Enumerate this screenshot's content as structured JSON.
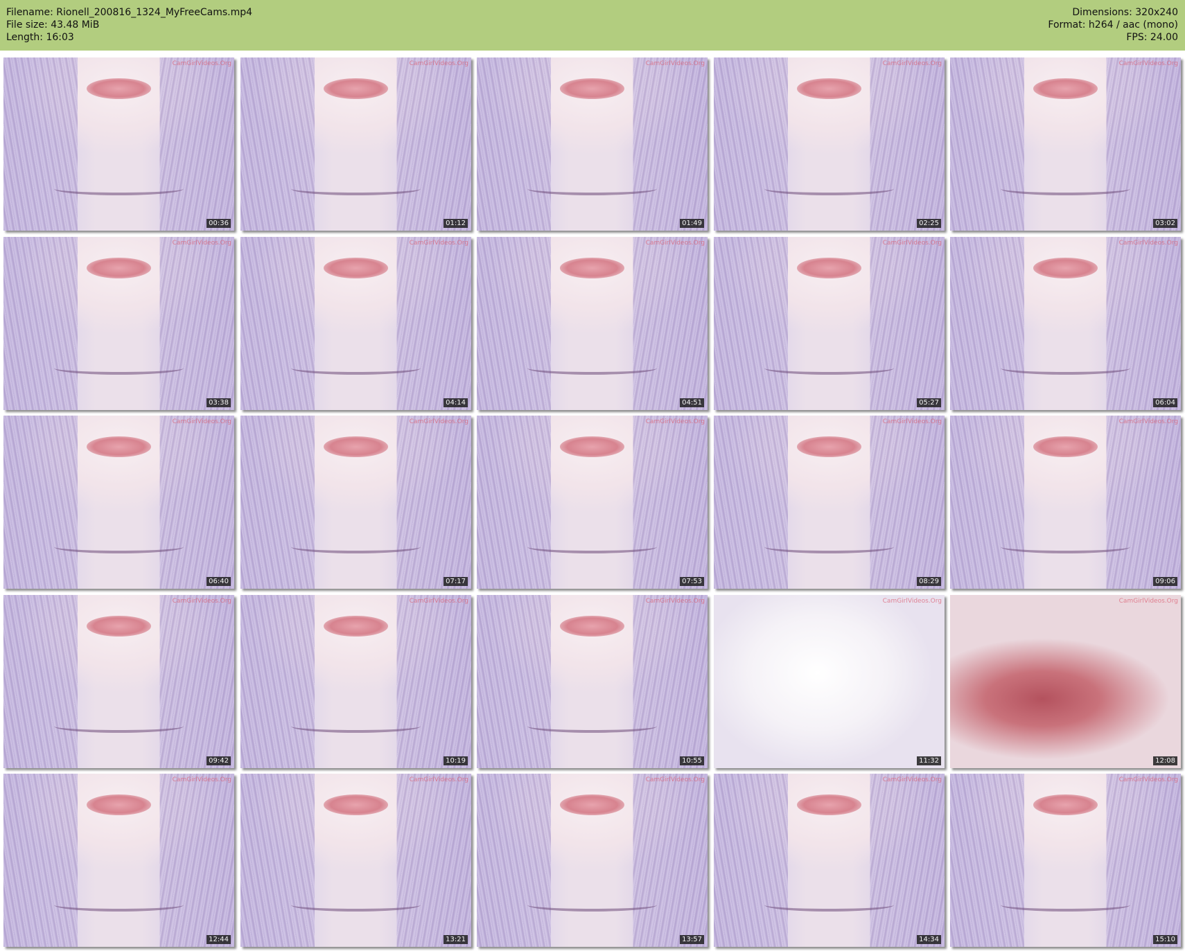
{
  "header": {
    "filename": "Filename: Rionell_200816_1324_MyFreeCams.mp4",
    "file_size": "File size: 43.48 MiB",
    "length": "Length: 16:03",
    "dimensions": "Dimensions: 320x240",
    "format": "Format: h264 / aac (mono)",
    "fps": "FPS: 24.00"
  },
  "watermark_text": "CamGirlVideos.Org",
  "colors": {
    "header_bg": "#b2cd7f",
    "timestamp_bg": "#1e1e1e"
  },
  "thumbnails": [
    {
      "time": "00:36"
    },
    {
      "time": "01:12"
    },
    {
      "time": "01:49"
    },
    {
      "time": "02:25"
    },
    {
      "time": "03:02"
    },
    {
      "time": "03:38"
    },
    {
      "time": "04:14"
    },
    {
      "time": "04:51"
    },
    {
      "time": "05:27"
    },
    {
      "time": "06:04"
    },
    {
      "time": "06:40"
    },
    {
      "time": "07:17"
    },
    {
      "time": "07:53"
    },
    {
      "time": "08:29"
    },
    {
      "time": "09:06"
    },
    {
      "time": "09:42"
    },
    {
      "time": "10:19"
    },
    {
      "time": "10:55"
    },
    {
      "time": "11:32"
    },
    {
      "time": "12:08"
    },
    {
      "time": "12:44"
    },
    {
      "time": "13:21"
    },
    {
      "time": "13:57"
    },
    {
      "time": "14:34"
    },
    {
      "time": "15:10"
    }
  ]
}
